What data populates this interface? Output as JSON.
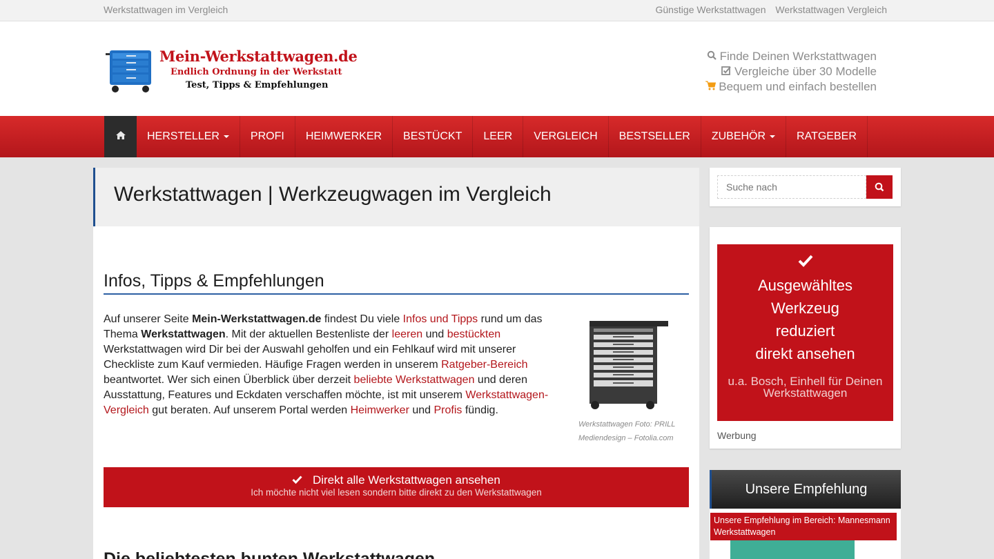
{
  "topbar": {
    "tagline": "Werkstattwagen im Vergleich",
    "links": [
      "Günstige Werkstattwagen",
      "Werkstattwagen Vergleich"
    ]
  },
  "logo": {
    "line1": "Mein-Werkstattwagen.de",
    "line2": "Endlich Ordnung in der Werkstatt",
    "line3": "Test, Tipps & Empfehlungen"
  },
  "features": [
    {
      "icon": "search-icon",
      "text": "Finde Deinen Werkstattwagen"
    },
    {
      "icon": "check-square-icon",
      "text": "Vergleiche über 30 Modelle"
    },
    {
      "icon": "cart-icon",
      "text": "Bequem und einfach bestellen"
    }
  ],
  "nav": {
    "items": [
      "Hersteller",
      "Profi",
      "Heimwerker",
      "Bestückt",
      "Leer",
      "Vergleich",
      "Bestseller",
      "Zubehör",
      "Ratgeber"
    ]
  },
  "main": {
    "title": "Werkstattwagen | Werkzeugwagen im Vergleich",
    "section_heading": "Infos, Tipps & Empfehlungen",
    "intro": {
      "t1": "Auf unserer Seite ",
      "b1": "Mein-Werkstattwagen.de",
      "t2": " findest Du viele ",
      "l1": "Infos und Tipps",
      "t3": " rund um das Thema ",
      "b2": "Werkstattwagen",
      "t4": ". Mit der aktuellen Bestenliste der ",
      "l2": "leeren",
      "t5": " und ",
      "l3": "bestückten",
      "t6": " Werkstattwagen wird Dir bei der Auswahl geholfen und ein Fehlkauf wird mit unserer Checkliste zum Kauf vermieden. Häufige Fragen werden in unserem ",
      "l4": "Ratgeber-Bereich",
      "t7": " beantwortet. Wer sich einen Überblick über derzeit ",
      "l5": "beliebte Werkstattwagen",
      "t8": " und deren Ausstattung, Features und Eckdaten verschaffen möchte, ist mit unserem ",
      "l6": "Werkstattwagen-Vergleich",
      "t9": " gut beraten. Auf unserem Portal werden ",
      "l7": "Heimwerker",
      "t10": " und ",
      "l8": "Profis",
      "t11": " fündig."
    },
    "image_caption": "Werkstattwagen Foto: PRILL Mediendesign – Fotolia.com",
    "cta": {
      "title": "Direkt alle Werkstattwagen ansehen",
      "subtitle": "Ich möchte nicht viel lesen sondern bitte direkt zu den Werkstattwagen"
    },
    "next_heading": "Die beliebtesten bunten Werkstattwagen"
  },
  "sidebar": {
    "search_placeholder": "Suche nach",
    "ad": {
      "line1": "Ausgewähltes",
      "line2": "Werkzeug",
      "line3": "reduziert",
      "line4": "direkt ansehen",
      "sub": "u.a. Bosch, Einhell für Deinen Werkstattwagen"
    },
    "werbung": "Werbung",
    "empfehlung_title": "Unsere Empfehlung",
    "empfehlung_label": "Unsere Empfehlung im Bereich: Mannesmann Werkstattwagen"
  },
  "colors": {
    "brand_red": "#c1121a",
    "accent_blue": "#1f4f8f"
  }
}
